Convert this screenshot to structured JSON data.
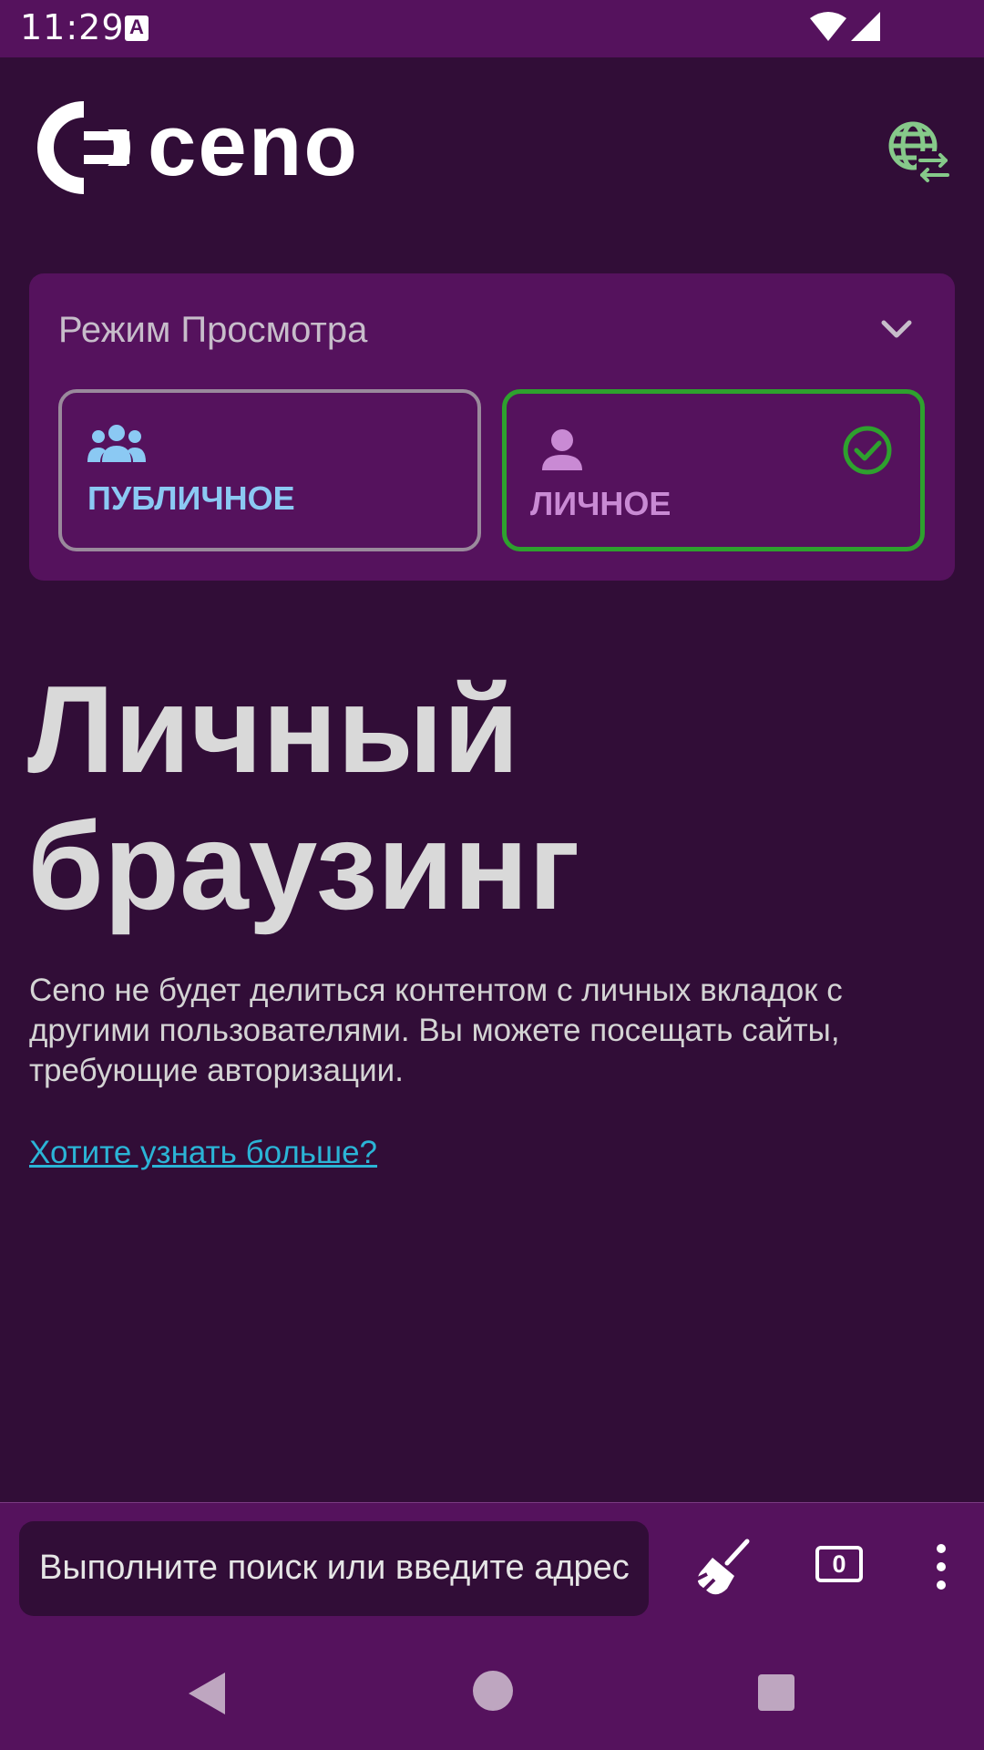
{
  "status_bar": {
    "time": "11:29",
    "a_icon": "A",
    "icons": [
      "text-a-icon",
      "wifi-icon",
      "signal-icon"
    ]
  },
  "header": {
    "logo_text": "ceno",
    "language_icon": "globe-swap-icon"
  },
  "mode_card": {
    "title": "Режим Просмотра",
    "options": [
      {
        "label": "ПУБЛИЧНОЕ",
        "icon": "group-people-icon",
        "selected": false
      },
      {
        "label": "ЛИЧНОЕ",
        "icon": "person-icon",
        "selected": true
      }
    ]
  },
  "hero": {
    "title": "Личный браузинг",
    "description": "Ceno не будет делиться контентом с личных вкладок с другими пользователями. Вы можете посещать сайты, требующие авторизации.",
    "link_text": "Хотите узнать больше?"
  },
  "toolbar": {
    "search_placeholder": "Выполните поиск или введите адрес",
    "tab_count": "0",
    "icons": [
      "clear-data-broom-icon",
      "tabs-counter-icon",
      "overflow-menu-icon"
    ]
  },
  "colors": {
    "background": "#310d37",
    "card": "#55125d",
    "selected_border": "#2ea12e",
    "public_label": "#8bc9f3",
    "personal_label": "#c98ad4",
    "link": "#2bb4d6"
  }
}
